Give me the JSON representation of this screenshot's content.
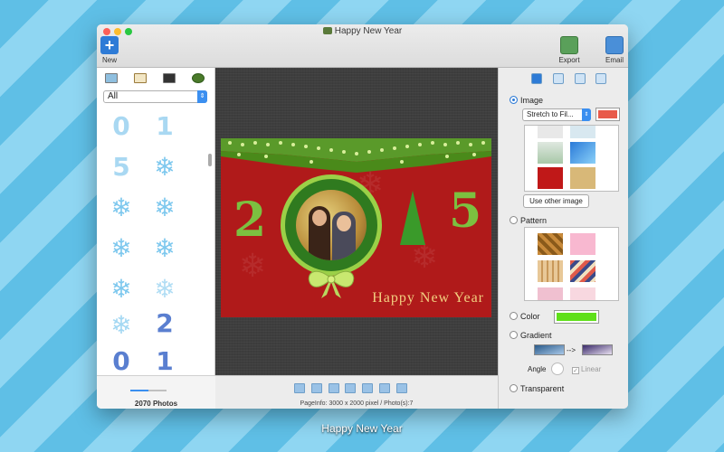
{
  "window": {
    "title": "Happy New Year"
  },
  "toolbar": {
    "new_label": "New",
    "export_label": "Export",
    "email_label": "Email"
  },
  "left_panel": {
    "filter_value": "All",
    "photo_count": "2070 Photos",
    "items": [
      "0",
      "1",
      "5",
      "❄",
      "❄",
      "❄",
      "❄",
      "❄",
      "❄",
      "❄",
      "❄",
      "2",
      "0",
      "1"
    ]
  },
  "canvas": {
    "card_greeting": "Happy New Year",
    "digit_left": "2",
    "digit_right": "5",
    "page_info": "PageInfo: 3000 x 2000 pixel / Photo(s):7"
  },
  "right_panel": {
    "image_label": "Image",
    "stretch_value": "Stretch to Fil...",
    "use_other_label": "Use other image",
    "pattern_label": "Pattern",
    "color_label": "Color",
    "gradient_label": "Gradient",
    "gradient_arrow": "-->",
    "angle_label": "Angle",
    "linear_label": "Linear",
    "transparent_label": "Transparent",
    "image_color": "#e85a4a",
    "solid_color": "#5fe01a"
  },
  "caption": "Happy New Year"
}
